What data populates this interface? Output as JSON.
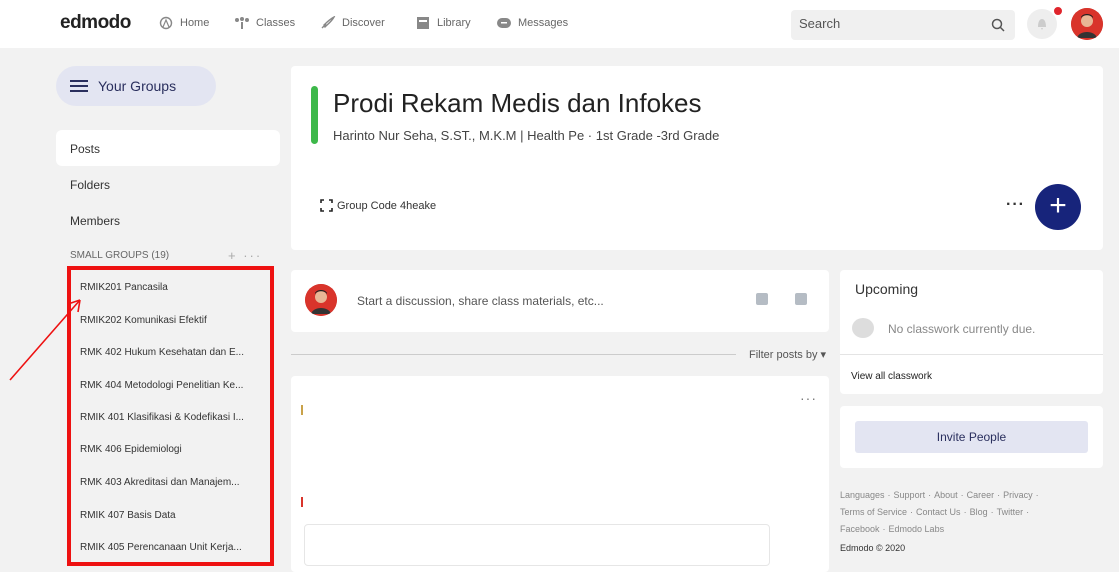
{
  "brand": "edmodo",
  "nav": [
    {
      "label": "Home",
      "icon": "home-icon"
    },
    {
      "label": "Classes",
      "icon": "classes-icon"
    },
    {
      "label": "Discover",
      "icon": "rocket-icon"
    },
    {
      "label": "Library",
      "icon": "library-icon"
    },
    {
      "label": "Messages",
      "icon": "chat-icon"
    }
  ],
  "search": {
    "placeholder": "Search"
  },
  "sidebar": {
    "your_groups": "Your Groups",
    "menu": [
      "Posts",
      "Folders",
      "Members"
    ],
    "small_groups_label": "SMALL GROUPS (19)",
    "small_groups": [
      "RMIK201 Pancasila",
      "RMIK202 Komunikasi Efektif",
      "RMK 402 Hukum Kesehatan dan E...",
      "RMK 404 Metodologi Penelitian Ke...",
      "RMIK 401 Klasifikasi & Kodefikasi I...",
      "RMK 406 Epidemiologi",
      "RMK 403 Akreditasi dan Manajem...",
      "RMIK 407 Basis Data",
      "RMIK 405 Perencanaan Unit Kerja..."
    ]
  },
  "group": {
    "title": "Prodi Rekam Medis dan Infokes",
    "subtitle": "Harinto Nur Seha, S.ST., M.K.M | Health Pe · 1st Grade -3rd Grade",
    "code_label": "Group Code 4heake"
  },
  "composer": {
    "placeholder": "Start a discussion, share class materials, etc..."
  },
  "feed": {
    "filter_label": "Filter posts by ▾"
  },
  "upcoming": {
    "title": "Upcoming",
    "empty": "No classwork currently due.",
    "view_all": "View all classwork"
  },
  "invite": {
    "label": "Invite People"
  },
  "footer": {
    "links": [
      "Languages",
      "Support",
      "About",
      "Career",
      "Privacy",
      "Terms of Service",
      "Contact Us",
      "Blog",
      "Twitter",
      "Facebook",
      "Edmodo Labs"
    ],
    "copyright": "Edmodo © 2020"
  },
  "colors": {
    "accent_green": "#3db84a",
    "primary_navy": "#17247b",
    "annotation_red": "#ee1111"
  }
}
